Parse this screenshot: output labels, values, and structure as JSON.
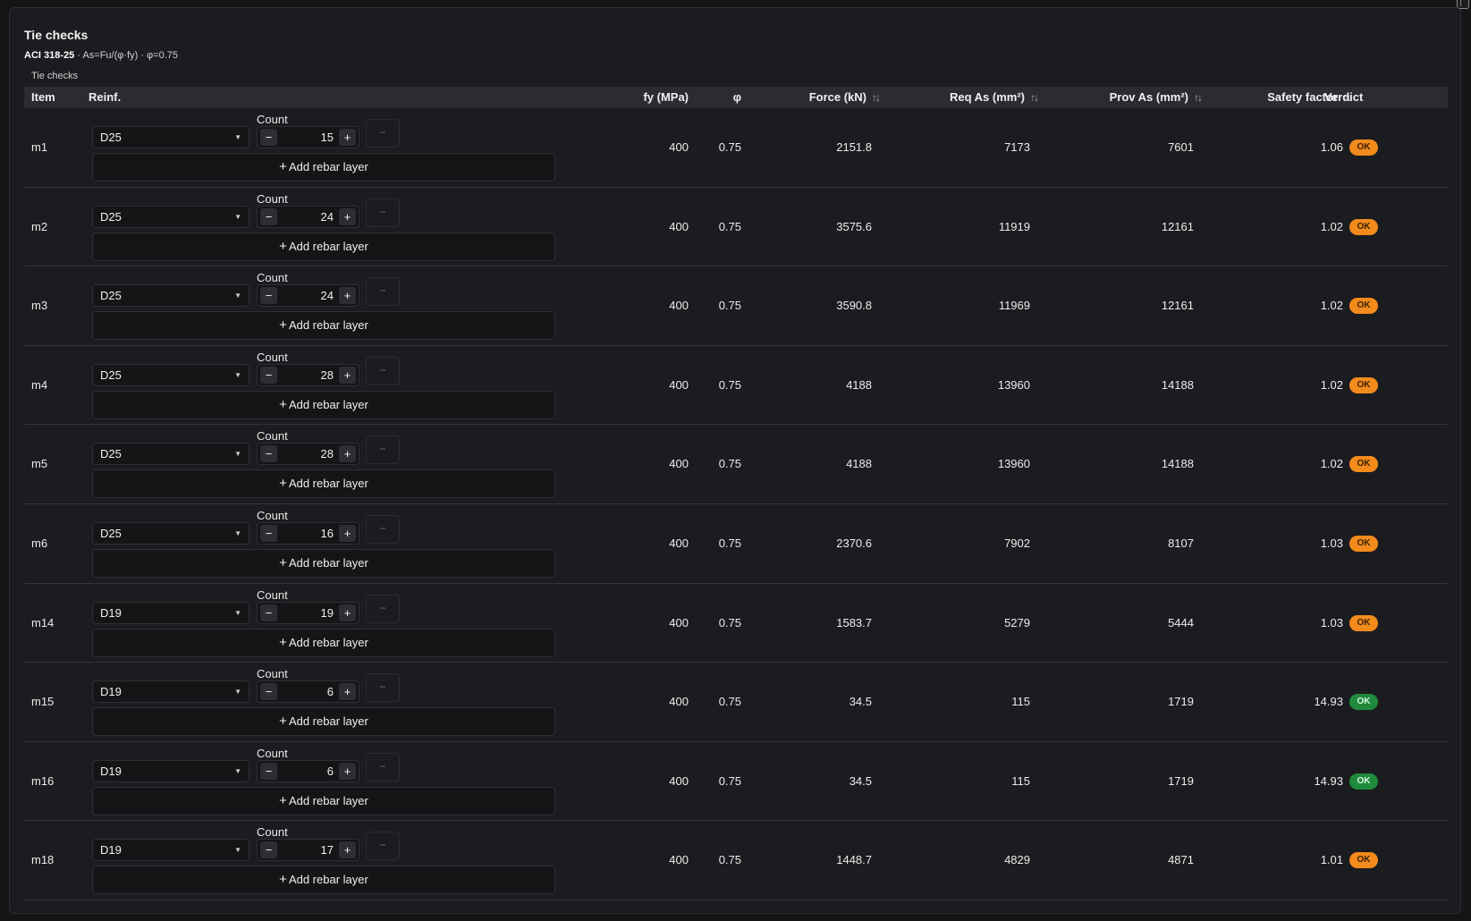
{
  "panel": {
    "title": "Tie checks",
    "subtitle_code": "ACI 318-25",
    "subtitle_rest": " · As=Fu/(φ·fy) · φ=0.75",
    "caption": "Tie checks"
  },
  "columns": {
    "item": "Item",
    "reinf": "Reinf.",
    "fy": "fy (MPa)",
    "phi": "φ",
    "force": "Force (kN)",
    "req": "Req As (mm²)",
    "prov": "Prov As (mm²)",
    "sf": "Safety factor",
    "verdict": "Verdict"
  },
  "labels": {
    "count": "Count",
    "add_layer": "Add rebar layer",
    "minus": "−",
    "plus": "+",
    "remove": "−"
  },
  "colors": {
    "badge_warn": "#f28a1c",
    "badge_ok": "#1f8a3c"
  },
  "rows": [
    {
      "item": "m1",
      "bar": "D25",
      "count": "15",
      "fy": "400",
      "phi": "0.75",
      "force": "2151.8",
      "req": "7173",
      "prov": "7601",
      "sf": "1.06",
      "verdict": "OK",
      "status": "warn"
    },
    {
      "item": "m2",
      "bar": "D25",
      "count": "24",
      "fy": "400",
      "phi": "0.75",
      "force": "3575.6",
      "req": "11919",
      "prov": "12161",
      "sf": "1.02",
      "verdict": "OK",
      "status": "warn"
    },
    {
      "item": "m3",
      "bar": "D25",
      "count": "24",
      "fy": "400",
      "phi": "0.75",
      "force": "3590.8",
      "req": "11969",
      "prov": "12161",
      "sf": "1.02",
      "verdict": "OK",
      "status": "warn"
    },
    {
      "item": "m4",
      "bar": "D25",
      "count": "28",
      "fy": "400",
      "phi": "0.75",
      "force": "4188",
      "req": "13960",
      "prov": "14188",
      "sf": "1.02",
      "verdict": "OK",
      "status": "warn"
    },
    {
      "item": "m5",
      "bar": "D25",
      "count": "28",
      "fy": "400",
      "phi": "0.75",
      "force": "4188",
      "req": "13960",
      "prov": "14188",
      "sf": "1.02",
      "verdict": "OK",
      "status": "warn"
    },
    {
      "item": "m6",
      "bar": "D25",
      "count": "16",
      "fy": "400",
      "phi": "0.75",
      "force": "2370.6",
      "req": "7902",
      "prov": "8107",
      "sf": "1.03",
      "verdict": "OK",
      "status": "warn"
    },
    {
      "item": "m14",
      "bar": "D19",
      "count": "19",
      "fy": "400",
      "phi": "0.75",
      "force": "1583.7",
      "req": "5279",
      "prov": "5444",
      "sf": "1.03",
      "verdict": "OK",
      "status": "warn"
    },
    {
      "item": "m15",
      "bar": "D19",
      "count": "6",
      "fy": "400",
      "phi": "0.75",
      "force": "34.5",
      "req": "115",
      "prov": "1719",
      "sf": "14.93",
      "verdict": "OK",
      "status": "ok"
    },
    {
      "item": "m16",
      "bar": "D19",
      "count": "6",
      "fy": "400",
      "phi": "0.75",
      "force": "34.5",
      "req": "115",
      "prov": "1719",
      "sf": "14.93",
      "verdict": "OK",
      "status": "ok"
    },
    {
      "item": "m18",
      "bar": "D19",
      "count": "17",
      "fy": "400",
      "phi": "0.75",
      "force": "1448.7",
      "req": "4829",
      "prov": "4871",
      "sf": "1.01",
      "verdict": "OK",
      "status": "warn"
    }
  ]
}
